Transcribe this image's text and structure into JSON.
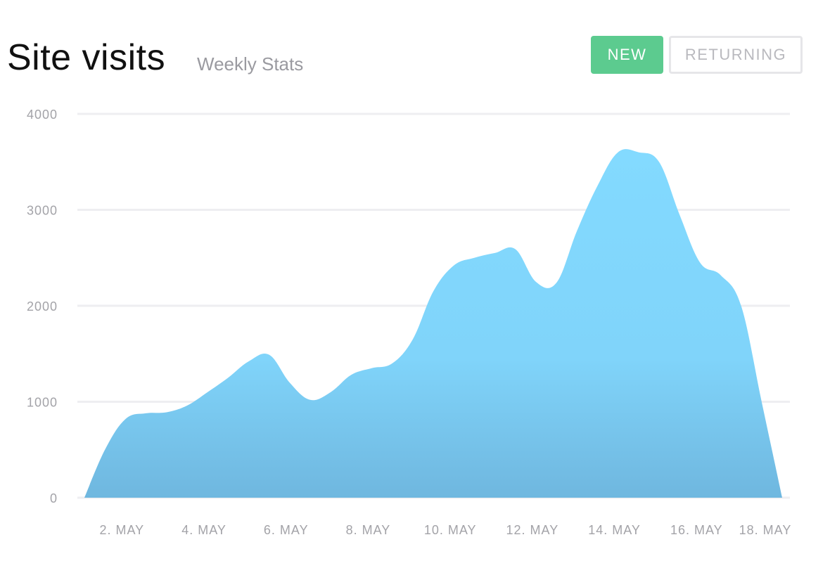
{
  "header": {
    "title": "Site visits",
    "subtitle": "Weekly Stats",
    "buttons": {
      "new": "NEW",
      "returning": "RETURNING"
    }
  },
  "colors": {
    "area_top": "#83daff",
    "area_bottom": "#6fb7df",
    "grid": "#eeeef1",
    "new_button": "#5ccb8f"
  },
  "chart_data": {
    "type": "area",
    "title": "Site visits",
    "subtitle": "Weekly Stats",
    "xlabel": "",
    "ylabel": "",
    "ylim": [
      0,
      4000
    ],
    "yticks": [
      0,
      1000,
      2000,
      3000,
      4000
    ],
    "xticks": [
      "2. MAY",
      "4. MAY",
      "6. MAY",
      "8. MAY",
      "10. MAY",
      "12. MAY",
      "14. MAY",
      "16. MAY",
      "18. MAY"
    ],
    "grid": true,
    "series": [
      {
        "x": [
          "1. MAY",
          "1.5 MAY",
          "2. MAY",
          "2.5 MAY",
          "3. MAY",
          "3.5 MAY",
          "4. MAY",
          "4.5 MAY",
          "5. MAY",
          "5.5 MAY",
          "6. MAY",
          "6.5 MAY",
          "7. MAY",
          "7.5 MAY",
          "8. MAY",
          "8.5 MAY",
          "9. MAY",
          "9.5 MAY",
          "10. MAY",
          "10.5 MAY",
          "11. MAY",
          "11.5 MAY",
          "12. MAY",
          "12.5 MAY",
          "13. MAY",
          "13.5 MAY",
          "14. MAY",
          "14.5 MAY",
          "15. MAY",
          "15.5 MAY",
          "16. MAY",
          "16.5 MAY",
          "17. MAY",
          "17.5 MAY",
          "18. MAY"
        ],
        "values": [
          0,
          500,
          820,
          880,
          890,
          960,
          1100,
          1250,
          1420,
          1490,
          1200,
          1020,
          1100,
          1280,
          1350,
          1400,
          1650,
          2150,
          2420,
          2500,
          2550,
          2590,
          2250,
          2240,
          2780,
          3250,
          3600,
          3600,
          3500,
          2950,
          2450,
          2320,
          2000,
          1000,
          0
        ]
      }
    ]
  }
}
